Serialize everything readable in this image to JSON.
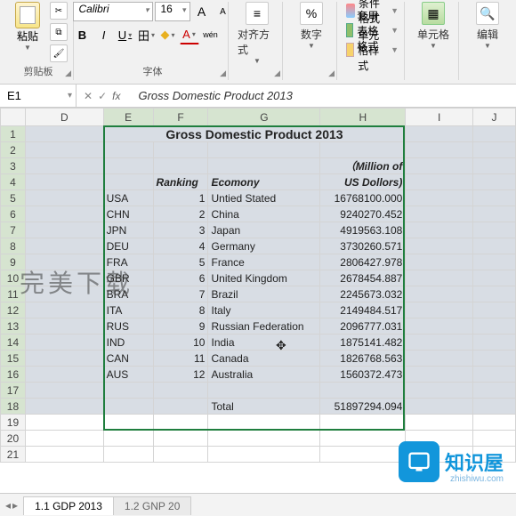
{
  "ribbon": {
    "clipboard": {
      "paste": "粘贴",
      "group": "剪贴板"
    },
    "font": {
      "name": "Calibri",
      "size": "16",
      "group": "字体",
      "bold": "B",
      "italic": "I",
      "underline": "U",
      "border": "田",
      "fill": "◆",
      "color": "A",
      "wen": "wén",
      "grow": "A",
      "shrink": "A"
    },
    "align": {
      "label": "对齐方式"
    },
    "number": {
      "label": "数字",
      "icon": "%"
    },
    "styles": {
      "cond": "条件格式",
      "tbl": "套用表格格式",
      "cell": "单元格样式"
    },
    "cells": {
      "label": "单元格"
    },
    "editing": {
      "label": "编辑"
    }
  },
  "namebox": "E1",
  "fx": "fx",
  "formula": "Gross Domestic Product 2013",
  "columns": [
    "D",
    "E",
    "F",
    "G",
    "H",
    "I",
    "J"
  ],
  "title": "Gross Domestic Product 2013",
  "subhead1": "（Million of",
  "headers": {
    "rank": "Ranking",
    "econ": "Ecomony",
    "usd": "US Dollors)"
  },
  "rows": [
    {
      "c": "USA",
      "r": "1",
      "e": "Untied Stated",
      "v": "16768100.000"
    },
    {
      "c": "CHN",
      "r": "2",
      "e": "China",
      "v": "9240270.452"
    },
    {
      "c": "JPN",
      "r": "3",
      "e": "Japan",
      "v": "4919563.108"
    },
    {
      "c": "DEU",
      "r": "4",
      "e": "Germany",
      "v": "3730260.571"
    },
    {
      "c": "FRA",
      "r": "5",
      "e": "France",
      "v": "2806427.978"
    },
    {
      "c": "GBR",
      "r": "6",
      "e": "United Kingdom",
      "v": "2678454.887"
    },
    {
      "c": "BRA",
      "r": "7",
      "e": "Brazil",
      "v": "2245673.032"
    },
    {
      "c": "ITA",
      "r": "8",
      "e": "Italy",
      "v": "2149484.517"
    },
    {
      "c": "RUS",
      "r": "9",
      "e": "Russian Federation",
      "v": "2096777.031"
    },
    {
      "c": "IND",
      "r": "10",
      "e": "India",
      "v": "1875141.482"
    },
    {
      "c": "CAN",
      "r": "11",
      "e": "Canada",
      "v": "1826768.563"
    },
    {
      "c": "AUS",
      "r": "12",
      "e": "Australia",
      "v": "1560372.473"
    }
  ],
  "total": {
    "label": "Total",
    "value": "51897294.094"
  },
  "tabs": {
    "t1": "1.1 GDP 2013",
    "t2": "1.2 GNP 20"
  },
  "watermark": "完美下载",
  "brand": {
    "name": "知识屋",
    "url": "zhishiwu.com"
  }
}
